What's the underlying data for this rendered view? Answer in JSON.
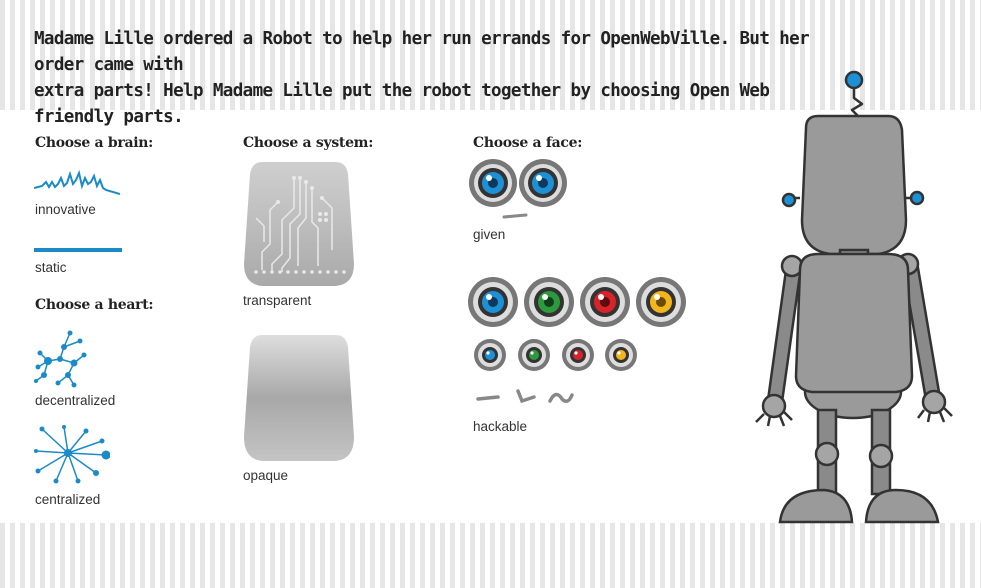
{
  "intro": {
    "line1": "Madame Lille ordered a Robot to help her run errands for OpenWebVille. But her order came with",
    "line2": "extra parts! Help Madame Lille put the robot together by choosing Open Web friendly parts."
  },
  "brain": {
    "heading": "Choose a brain:",
    "options": [
      {
        "label": "innovative",
        "icon": "wave-line-icon"
      },
      {
        "label": "static",
        "icon": "flat-line-icon"
      }
    ]
  },
  "heart": {
    "heading": "Choose a heart:",
    "options": [
      {
        "label": "decentralized",
        "icon": "decentralized-network-icon"
      },
      {
        "label": "centralized",
        "icon": "centralized-network-icon"
      }
    ]
  },
  "system": {
    "heading": "Choose a system:",
    "options": [
      {
        "label": "transparent",
        "icon": "circuit-board-body-icon"
      },
      {
        "label": "opaque",
        "icon": "opaque-body-icon"
      }
    ]
  },
  "face": {
    "heading": "Choose a face:",
    "options": [
      {
        "label": "given",
        "icon": "fixed-blue-eyes-icon"
      },
      {
        "label": "hackable",
        "icon": "colorful-swappable-eyes-icon"
      }
    ]
  },
  "colors": {
    "accent": "#1b8bc8",
    "eye_blue": "#1e90d6",
    "eye_green": "#2e9a3e",
    "eye_red": "#d8232a",
    "eye_yellow": "#f2b51c",
    "robot_gray": "#9a9a9a"
  }
}
